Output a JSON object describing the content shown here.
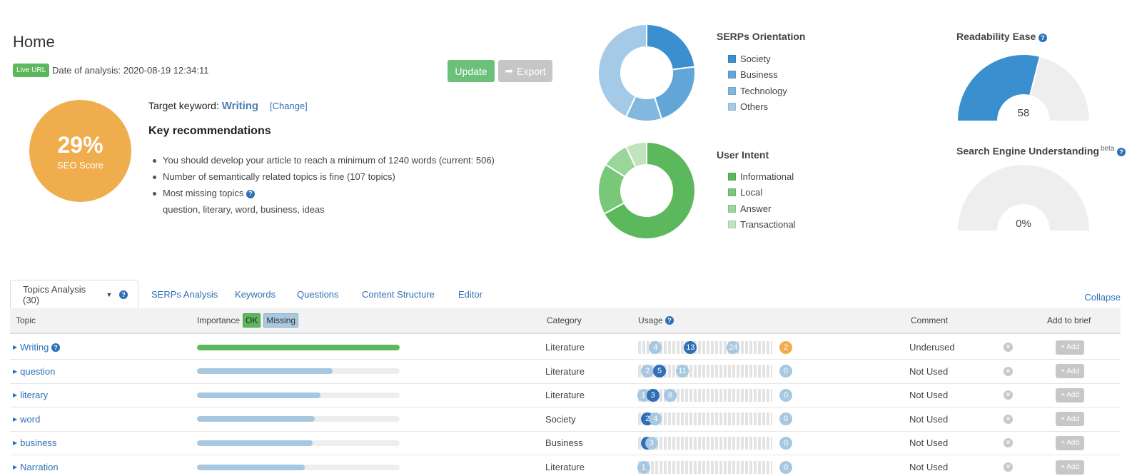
{
  "header": {
    "title": "Home",
    "live_badge": "Live URL",
    "analysis_date": "Date of analysis: 2020-08-19 12:34:11",
    "update_label": "Update",
    "export_label": "Export"
  },
  "score": {
    "value": "29%",
    "label": "SEO Score",
    "color": "#f0ad4e"
  },
  "target": {
    "label": "Target keyword:",
    "keyword": "Writing",
    "change_label": "[Change]"
  },
  "recommendations": {
    "title": "Key recommendations",
    "items": [
      "You should develop your article to reach a minimum of 1240 words (current: 506)",
      "Number of semantically related topics is fine (107 topics)",
      "Most missing topics"
    ],
    "missing_topics": "question, literary, word, business, ideas"
  },
  "chart_data": [
    {
      "type": "pie",
      "title": "SERPs Orientation",
      "categories": [
        "Society",
        "Business",
        "Technology",
        "Others"
      ],
      "values": [
        23,
        22,
        12,
        43
      ],
      "colors": [
        "#3a8fcf",
        "#62a6d8",
        "#82b8e0",
        "#a5cae8"
      ],
      "legend": "right"
    },
    {
      "type": "pie",
      "title": "User Intent",
      "categories": [
        "Informational",
        "Local",
        "Answer",
        "Transactional"
      ],
      "values": [
        67,
        17,
        9,
        7
      ],
      "colors": [
        "#5cb85c",
        "#79c879",
        "#9ad59a",
        "#bfe4bf"
      ],
      "legend": "right"
    }
  ],
  "gauges": [
    {
      "title": "Readability Ease",
      "superscript": "",
      "value_text": "58",
      "fraction": 0.58,
      "color": "#3a8fcf"
    },
    {
      "title": "Search Engine Understanding",
      "superscript": "beta",
      "value_text": "0%",
      "fraction": 0.0,
      "color": "#3a8fcf"
    }
  ],
  "tabs": [
    {
      "label": "Topics Analysis (30)"
    },
    {
      "label": "SERPs Analysis"
    },
    {
      "label": "Keywords"
    },
    {
      "label": "Questions"
    },
    {
      "label": "Content Structure"
    },
    {
      "label": "Editor"
    }
  ],
  "collapse_label": "Collapse",
  "table": {
    "headers": {
      "topic": "Topic",
      "importance": "Importance",
      "ok": "OK",
      "missing": "Missing",
      "category": "Category",
      "usage": "Usage",
      "comment": "Comment",
      "add_to_brief": "Add to brief"
    },
    "add_label": "+ Add",
    "rows": [
      {
        "topic": "Writing",
        "has_help": true,
        "importance": 1.0,
        "imp_color": "#5cb85c",
        "category": "Literature",
        "usage": [
          [
            "4",
            0.13,
            "#a7c8e0"
          ],
          [
            "13",
            0.39,
            "#2e6fb6"
          ],
          [
            "24",
            0.71,
            "#a7c8e0"
          ]
        ],
        "count": "2",
        "count_color": "#f0ad4e",
        "comment": "Underused"
      },
      {
        "topic": "question",
        "has_help": false,
        "importance": 0.67,
        "imp_color": "#a7c8e0",
        "category": "Literature",
        "usage": [
          [
            "2",
            0.07,
            "#a7c8e0"
          ],
          [
            "5",
            0.16,
            "#2e6fb6"
          ],
          [
            "11",
            0.33,
            "#a7c8e0"
          ]
        ],
        "count": "0",
        "count_color": "#a7c8e0",
        "comment": "Not Used"
      },
      {
        "topic": "literary",
        "has_help": false,
        "importance": 0.61,
        "imp_color": "#a7c8e0",
        "category": "Literature",
        "usage": [
          [
            "1",
            0.04,
            "#a7c8e0"
          ],
          [
            "3",
            0.11,
            "#2e6fb6"
          ],
          [
            "8",
            0.24,
            "#a7c8e0"
          ]
        ],
        "count": "0",
        "count_color": "#a7c8e0",
        "comment": "Not Used"
      },
      {
        "topic": "word",
        "has_help": false,
        "importance": 0.58,
        "imp_color": "#a7c8e0",
        "category": "Society",
        "usage": [
          [
            "2",
            0.07,
            "#2e6fb6"
          ],
          [
            "4",
            0.13,
            "#a7c8e0"
          ]
        ],
        "count": "0",
        "count_color": "#a7c8e0",
        "comment": "Not Used"
      },
      {
        "topic": "business",
        "has_help": false,
        "importance": 0.57,
        "imp_color": "#a7c8e0",
        "category": "Business",
        "usage": [
          [
            "",
            0.07,
            "#2e6fb6"
          ],
          [
            "3",
            0.1,
            "#a7c8e0"
          ]
        ],
        "count": "0",
        "count_color": "#a7c8e0",
        "comment": "Not Used"
      },
      {
        "topic": "Narration",
        "has_help": false,
        "importance": 0.53,
        "imp_color": "#a7c8e0",
        "category": "Literature",
        "usage": [
          [
            "1",
            0.04,
            "#a7c8e0"
          ]
        ],
        "count": "0",
        "count_color": "#a7c8e0",
        "comment": "Not Used"
      }
    ]
  }
}
